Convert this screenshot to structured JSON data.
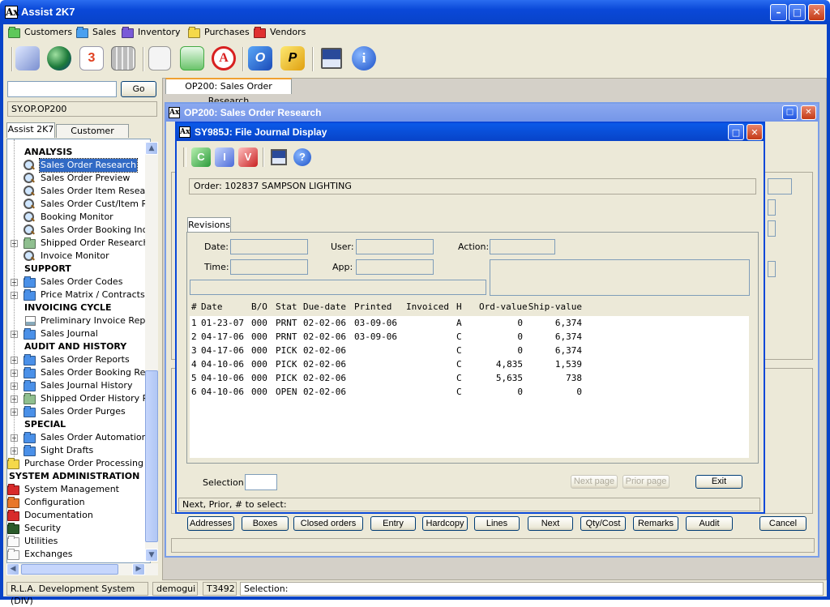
{
  "app": {
    "title": "Assist 2K7",
    "logo": "Ax"
  },
  "menu": [
    {
      "label": "Customers",
      "color": "#5ec85a"
    },
    {
      "label": "Sales",
      "color": "#4aa0f0"
    },
    {
      "label": "Inventory",
      "color": "#7a5ad8"
    },
    {
      "label": "Purchases",
      "color": "#f5d94a"
    },
    {
      "label": "Vendors",
      "color": "#e03030"
    }
  ],
  "toolbar_icons": [
    "mail-icon",
    "globe-icon",
    "calendar-icon",
    "calculator-icon",
    "document-icon",
    "chart-icon",
    "acrobat-icon",
    "outlook-icon",
    "publisher-icon",
    "image-icon",
    "info-icon"
  ],
  "search": {
    "value": "",
    "go_label": "Go",
    "path": "SY.OP.OP200"
  },
  "nav_tabs": [
    "Assist 2K7",
    "Customer Service"
  ],
  "tree": [
    {
      "label": "ANALYSIS",
      "type": "header"
    },
    {
      "label": "Sales Order Research",
      "type": "mag",
      "selected": true
    },
    {
      "label": "Sales Order Preview",
      "type": "mag"
    },
    {
      "label": "Sales Order Item Research",
      "type": "mag"
    },
    {
      "label": "Sales Order Cust/Item Res",
      "type": "mag"
    },
    {
      "label": "Booking Monitor",
      "type": "mag"
    },
    {
      "label": "Sales Order Booking Inquir",
      "type": "mag"
    },
    {
      "label": "Shipped Order Researches",
      "type": "folder-gray",
      "expand": true
    },
    {
      "label": "Invoice Monitor",
      "type": "mag"
    },
    {
      "label": "SUPPORT",
      "type": "header"
    },
    {
      "label": "Sales Order Codes",
      "type": "folder",
      "expand": true
    },
    {
      "label": "Price Matrix / Contracts",
      "type": "folder",
      "expand": true
    },
    {
      "label": "INVOICING CYCLE",
      "type": "header"
    },
    {
      "label": "Preliminary Invoice Report",
      "type": "doc"
    },
    {
      "label": "Sales Journal",
      "type": "folder",
      "expand": true
    },
    {
      "label": "AUDIT AND HISTORY",
      "type": "header"
    },
    {
      "label": "Sales Order Reports",
      "type": "folder",
      "expand": true
    },
    {
      "label": "Sales Order Booking Repor",
      "type": "folder",
      "expand": true
    },
    {
      "label": "Sales Journal History",
      "type": "folder",
      "expand": true
    },
    {
      "label": "Shipped Order History Rep",
      "type": "folder-gray",
      "expand": true
    },
    {
      "label": "Sales Order Purges",
      "type": "folder",
      "expand": true
    },
    {
      "label": "SPECIAL",
      "type": "header"
    },
    {
      "label": "Sales Order Automation",
      "type": "folder",
      "expand": true
    },
    {
      "label": "Sight Drafts",
      "type": "folder",
      "expand": true
    },
    {
      "label": "Purchase Order Processing",
      "type": "top-yellow"
    },
    {
      "label": "SYSTEM ADMINISTRATION",
      "type": "top-header"
    },
    {
      "label": "System Management",
      "type": "top-red"
    },
    {
      "label": "Configuration",
      "type": "top-orange"
    },
    {
      "label": "Documentation",
      "type": "top-red"
    },
    {
      "label": "Security",
      "type": "top-dark"
    },
    {
      "label": "Utilities",
      "type": "top-white"
    },
    {
      "label": "Exchanges",
      "type": "top-white"
    }
  ],
  "doc_tab": "OP200: Sales Order Research",
  "op200": {
    "title": "OP200: Sales Order Research",
    "buttons": [
      "Addresses",
      "Boxes",
      "Closed orders",
      "Entry",
      "Hardcopy",
      "Lines",
      "Next",
      "Qty/Cost",
      "Remarks",
      "Audit"
    ],
    "cancel": "Cancel"
  },
  "journal": {
    "title": "SY985J: File Journal Display",
    "order": "Order: 102837  SAMPSON LIGHTING",
    "tab": "Revisions",
    "labels": {
      "date": "Date:",
      "user": "User:",
      "action": "Action:",
      "time": "Time:",
      "app": "App:"
    },
    "columns": [
      "#",
      "Date",
      "B/O",
      "Stat",
      "Due-date",
      "Printed",
      "Invoiced",
      "H",
      "Ord-value",
      "Ship-value"
    ],
    "rows": [
      [
        "1",
        "01-23-07",
        "000",
        "PRNT",
        "02-02-06",
        "03-09-06",
        "",
        "A",
        "0",
        "6,374"
      ],
      [
        "2",
        "04-17-06",
        "000",
        "PRNT",
        "02-02-06",
        "03-09-06",
        "",
        "C",
        "0",
        "6,374"
      ],
      [
        "3",
        "04-17-06",
        "000",
        "PICK",
        "02-02-06",
        "",
        "",
        "C",
        "0",
        "6,374"
      ],
      [
        "4",
        "04-10-06",
        "000",
        "PICK",
        "02-02-06",
        "",
        "",
        "C",
        "4,835",
        "1,539"
      ],
      [
        "5",
        "04-10-06",
        "000",
        "PICK",
        "02-02-06",
        "",
        "",
        "C",
        "5,635",
        "738"
      ],
      [
        "6",
        "04-10-06",
        "000",
        "OPEN",
        "02-02-06",
        "",
        "",
        "C",
        "0",
        "0"
      ]
    ],
    "selection_label": "Selection:",
    "next_page": "Next page",
    "prior_page": "Prior page",
    "exit": "Exit",
    "hint": "Next,  Prior,  # to select:"
  },
  "status": {
    "system": "R.L.A. Development System (DIV)",
    "user": "demogui",
    "terminal": "T3492",
    "selection": "Selection:"
  }
}
